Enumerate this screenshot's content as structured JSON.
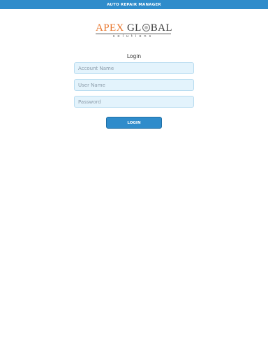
{
  "header": {
    "title": "AUTO REPAIR MANAGER"
  },
  "logo": {
    "word1": "APEX",
    "word2_a": "GL",
    "word2_b": "BAL",
    "tagline": "solutions"
  },
  "login": {
    "title": "Login",
    "account_placeholder": "Account Name",
    "username_placeholder": "User Name",
    "password_placeholder": "Password",
    "button_label": "LOGIN"
  },
  "colors": {
    "header_bg": "#2f8ccb",
    "brand_orange": "#e8772e",
    "input_bg": "#e3f3fc",
    "button_bg": "#2f8ccb"
  }
}
